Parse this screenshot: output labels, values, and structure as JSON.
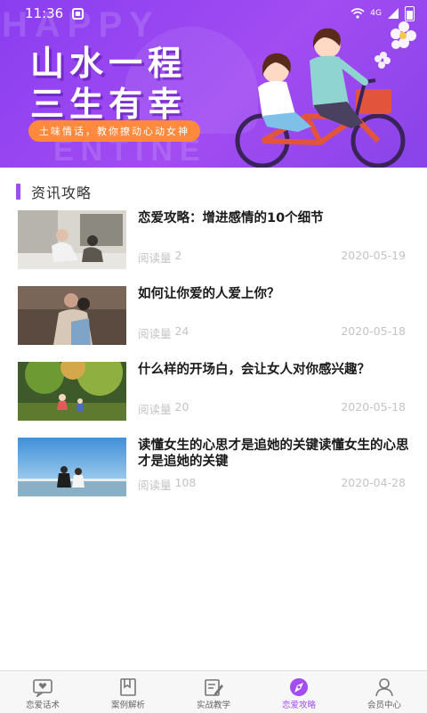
{
  "status_bar": {
    "time": "11:36",
    "network": "4G"
  },
  "banner": {
    "title_line1": "山水一程",
    "title_line2": "三生有幸",
    "subtitle": "土味情话，教你撩动心动女神",
    "bg_text_top": "HAPPY",
    "bg_text_bottom": "ENTINE",
    "colors": {
      "purple": "#a24cf2",
      "accent": "#ff8a3d"
    }
  },
  "section": {
    "title": "资讯攻略"
  },
  "articles": [
    {
      "title": "恋爱攻略：增进感情的10个细节",
      "read_label": "阅读量",
      "reads": "2",
      "date": "2020-05-19",
      "image": "couple-sitting-photo"
    },
    {
      "title": "如何让你爱的人爱上你？",
      "read_label": "阅读量",
      "reads": "24",
      "date": "2020-05-18",
      "image": "couple-hug-photo"
    },
    {
      "title": "什么样的开场白，会让女人对你感兴趣？",
      "read_label": "阅读量",
      "reads": "20",
      "date": "2020-05-18",
      "image": "forest-illustration"
    },
    {
      "title": "读懂女生的心思才是追她的关键读懂女生的心思才是追她的关键",
      "read_label": "阅读量",
      "reads": "108",
      "date": "2020-04-28",
      "image": "couple-seaside-photo"
    }
  ],
  "tabbar": {
    "active": "恋爱攻略",
    "items": [
      {
        "label": "恋爱话术",
        "icon": "chat-heart-icon"
      },
      {
        "label": "案例解析",
        "icon": "bookmark-icon"
      },
      {
        "label": "实战教学",
        "icon": "edit-note-icon"
      },
      {
        "label": "恋爱攻略",
        "icon": "compass-icon"
      },
      {
        "label": "会员中心",
        "icon": "person-icon"
      }
    ]
  }
}
